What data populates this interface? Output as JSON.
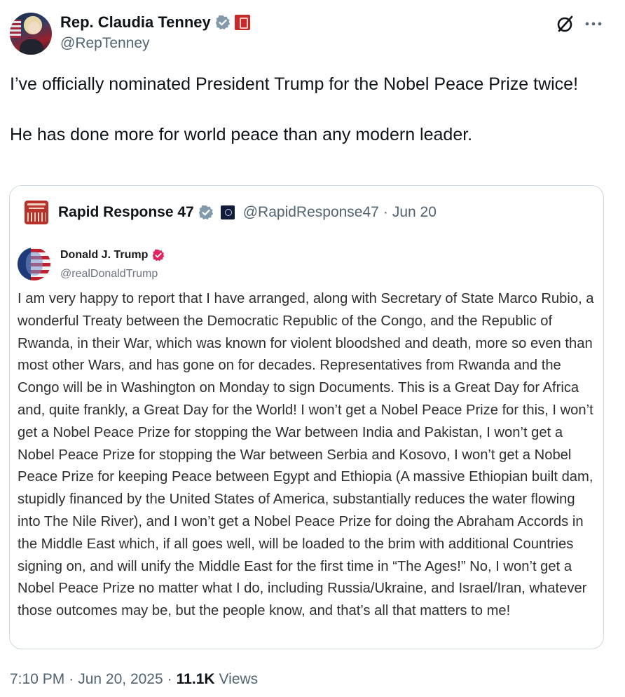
{
  "post": {
    "author": {
      "display_name": "Rep. Claudia Tenney",
      "handle": "@RepTenney",
      "verified_badge_color": "#829aab",
      "affiliation_badge_color": "#c52b2b"
    },
    "text_paragraphs": [
      "I’ve officially nominated President Trump for the Nobel Peace Prize twice!",
      "He has done more for world peace than any modern leader."
    ],
    "timestamp_time": "7:10 PM",
    "timestamp_date": "Jun 20, 2025",
    "views_count": "11.1K",
    "views_label": "Views",
    "separator": "·"
  },
  "quote": {
    "author": {
      "display_name": "Rapid Response 47",
      "handle": "@RapidResponse47",
      "date": "Jun 20",
      "separator": "·",
      "verified_badge_color": "#829aab"
    },
    "embedded": {
      "author_name": "Donald J. Trump",
      "author_handle": "@realDonaldTrump",
      "verified_badge_color": "#e0245e",
      "body": "I am very happy to report that I have arranged, along with Secretary of State Marco Rubio, a wonderful Treaty between the Democratic Republic of the Congo, and the Republic of Rwanda, in their War, which was known for violent bloodshed and death, more so even than most other Wars, and has gone on for decades. Representatives from Rwanda and the Congo will be in Washington on Monday to sign Documents. This is a Great Day for Africa and, quite frankly, a Great Day for the World! I won’t get a Nobel Peace Prize for this, I won’t get a Nobel Peace Prize for stopping the War between India and Pakistan, I won’t get a Nobel Peace Prize for stopping the War between Serbia and Kosovo, I won’t get a Nobel Peace Prize for keeping Peace between Egypt and Ethiopia (A massive Ethiopian built dam, stupidly financed by the United States of America, substantially reduces the water flowing into The Nile River), and I won’t get a Nobel Peace Prize for doing the Abraham Accords in the Middle East which, if all goes well, will be loaded to the brim with additional Countries signing on, and will unify the Middle East for the first time in “The Ages!” No, I won’t get a Nobel Peace Prize no matter what I do, including Russia/Ukraine, and Israel/Iran, whatever those outcomes may be, but the people know, and that’s all that matters to me!"
    }
  },
  "icons": {
    "grok": "grok-icon",
    "more": "more-options-icon",
    "verified": "verified-badge-icon"
  }
}
